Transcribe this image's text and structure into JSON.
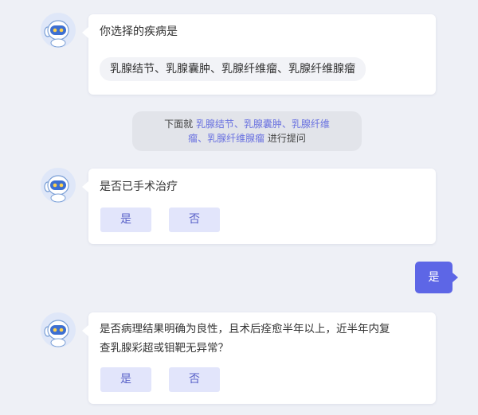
{
  "messages": {
    "disease_prompt": "你选择的疾病是",
    "disease_list": "乳腺结节、乳腺囊肿、乳腺纤维瘤、乳腺纤维腺瘤",
    "notice_prefix": "下面就",
    "notice_diseases_line1": "乳腺结节、乳腺囊肿、乳腺纤维",
    "notice_diseases_line2": "瘤、乳腺纤维腺瘤",
    "notice_suffix": "进行提问",
    "q1_text": "是否已手术治疗",
    "q1_yes": "是",
    "q1_no": "否",
    "user_answer": "是",
    "q2_line1": "是否病理结果明确为良性，且术后痊愈半年以上，近半年内复",
    "q2_line2": "查乳腺彩超或钼靶无异常？",
    "q2_yes": "是",
    "q2_no": "否"
  },
  "icons": {
    "bot_avatar": "robot-avatar-icon"
  },
  "colors": {
    "accent": "#5d66e6",
    "highlight_text": "#6a72e0",
    "button_bg": "#e2e5fb",
    "page_bg": "#eef0f6"
  }
}
